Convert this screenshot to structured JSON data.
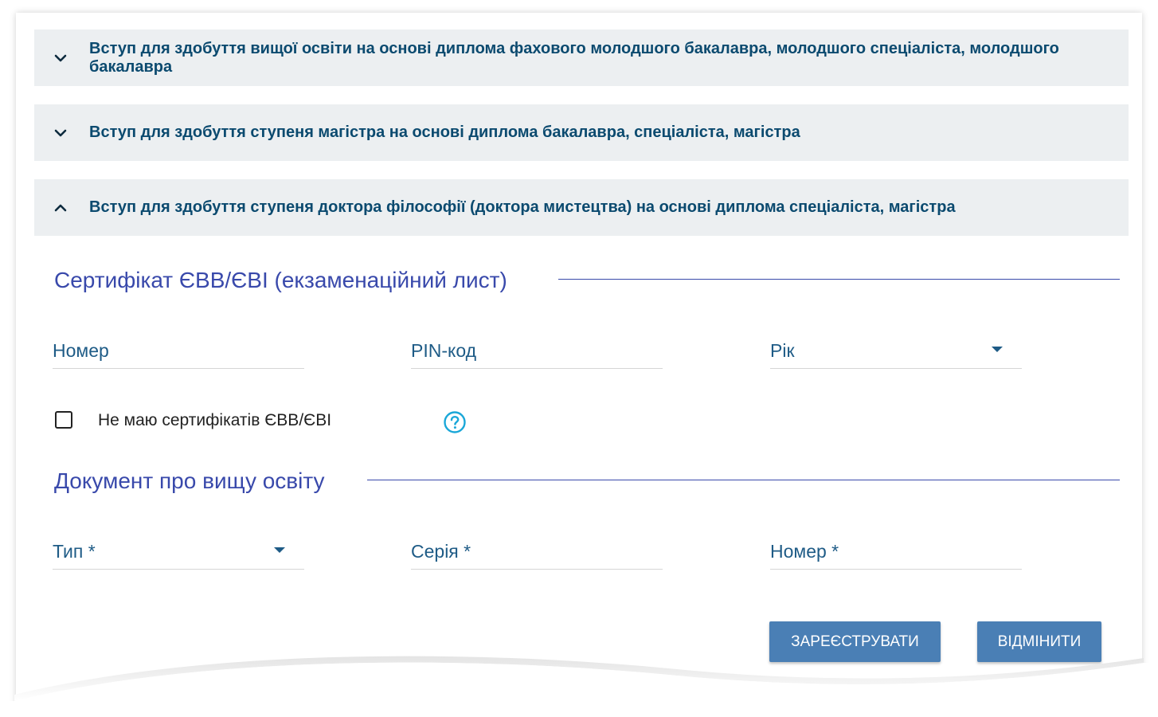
{
  "accordion": [
    {
      "title": "Вступ для здобуття вищої освіти на основі диплома фахового молодшого бакалавра, молодшого спеціаліста, молодшого бакалавра",
      "expanded": false
    },
    {
      "title": "Вступ для здобуття ступеня магістра на основі диплома бакалавра, спеціаліста, магістра",
      "expanded": false
    },
    {
      "title": "Вступ для здобуття ступеня доктора філософії (доктора мистецтва) на основі диплома спеціаліста, магістра",
      "expanded": true
    }
  ],
  "certificate": {
    "title": "Сертифікат ЄВВ/ЄВІ (екзаменаційний лист)",
    "number_label": "Номер",
    "pin_label": "PIN-код",
    "year_label": "Рік",
    "no_cert_label": "Не маю сертифікатів ЄВВ/ЄВІ",
    "no_cert_checked": false
  },
  "document": {
    "title": "Документ про вищу освіту",
    "type_label": "Тип *",
    "series_label": "Серія *",
    "number_label": "Номер *"
  },
  "actions": {
    "register_label": "ЗАРЕЄСТРУВАТИ",
    "cancel_label": "ВІДМІНИТИ"
  },
  "colors": {
    "accent": "#3949ab",
    "header_text": "#0b4a6f",
    "field_label": "#1e5b86",
    "button": "#4a7fb5",
    "help_icon": "#1aa7d8",
    "accordion_bg": "#eceff1"
  },
  "icons": {
    "collapsed": "chevron-down-icon",
    "expanded": "chevron-up-icon",
    "help": "help-circle-icon",
    "dropdown": "caret-down-icon"
  }
}
